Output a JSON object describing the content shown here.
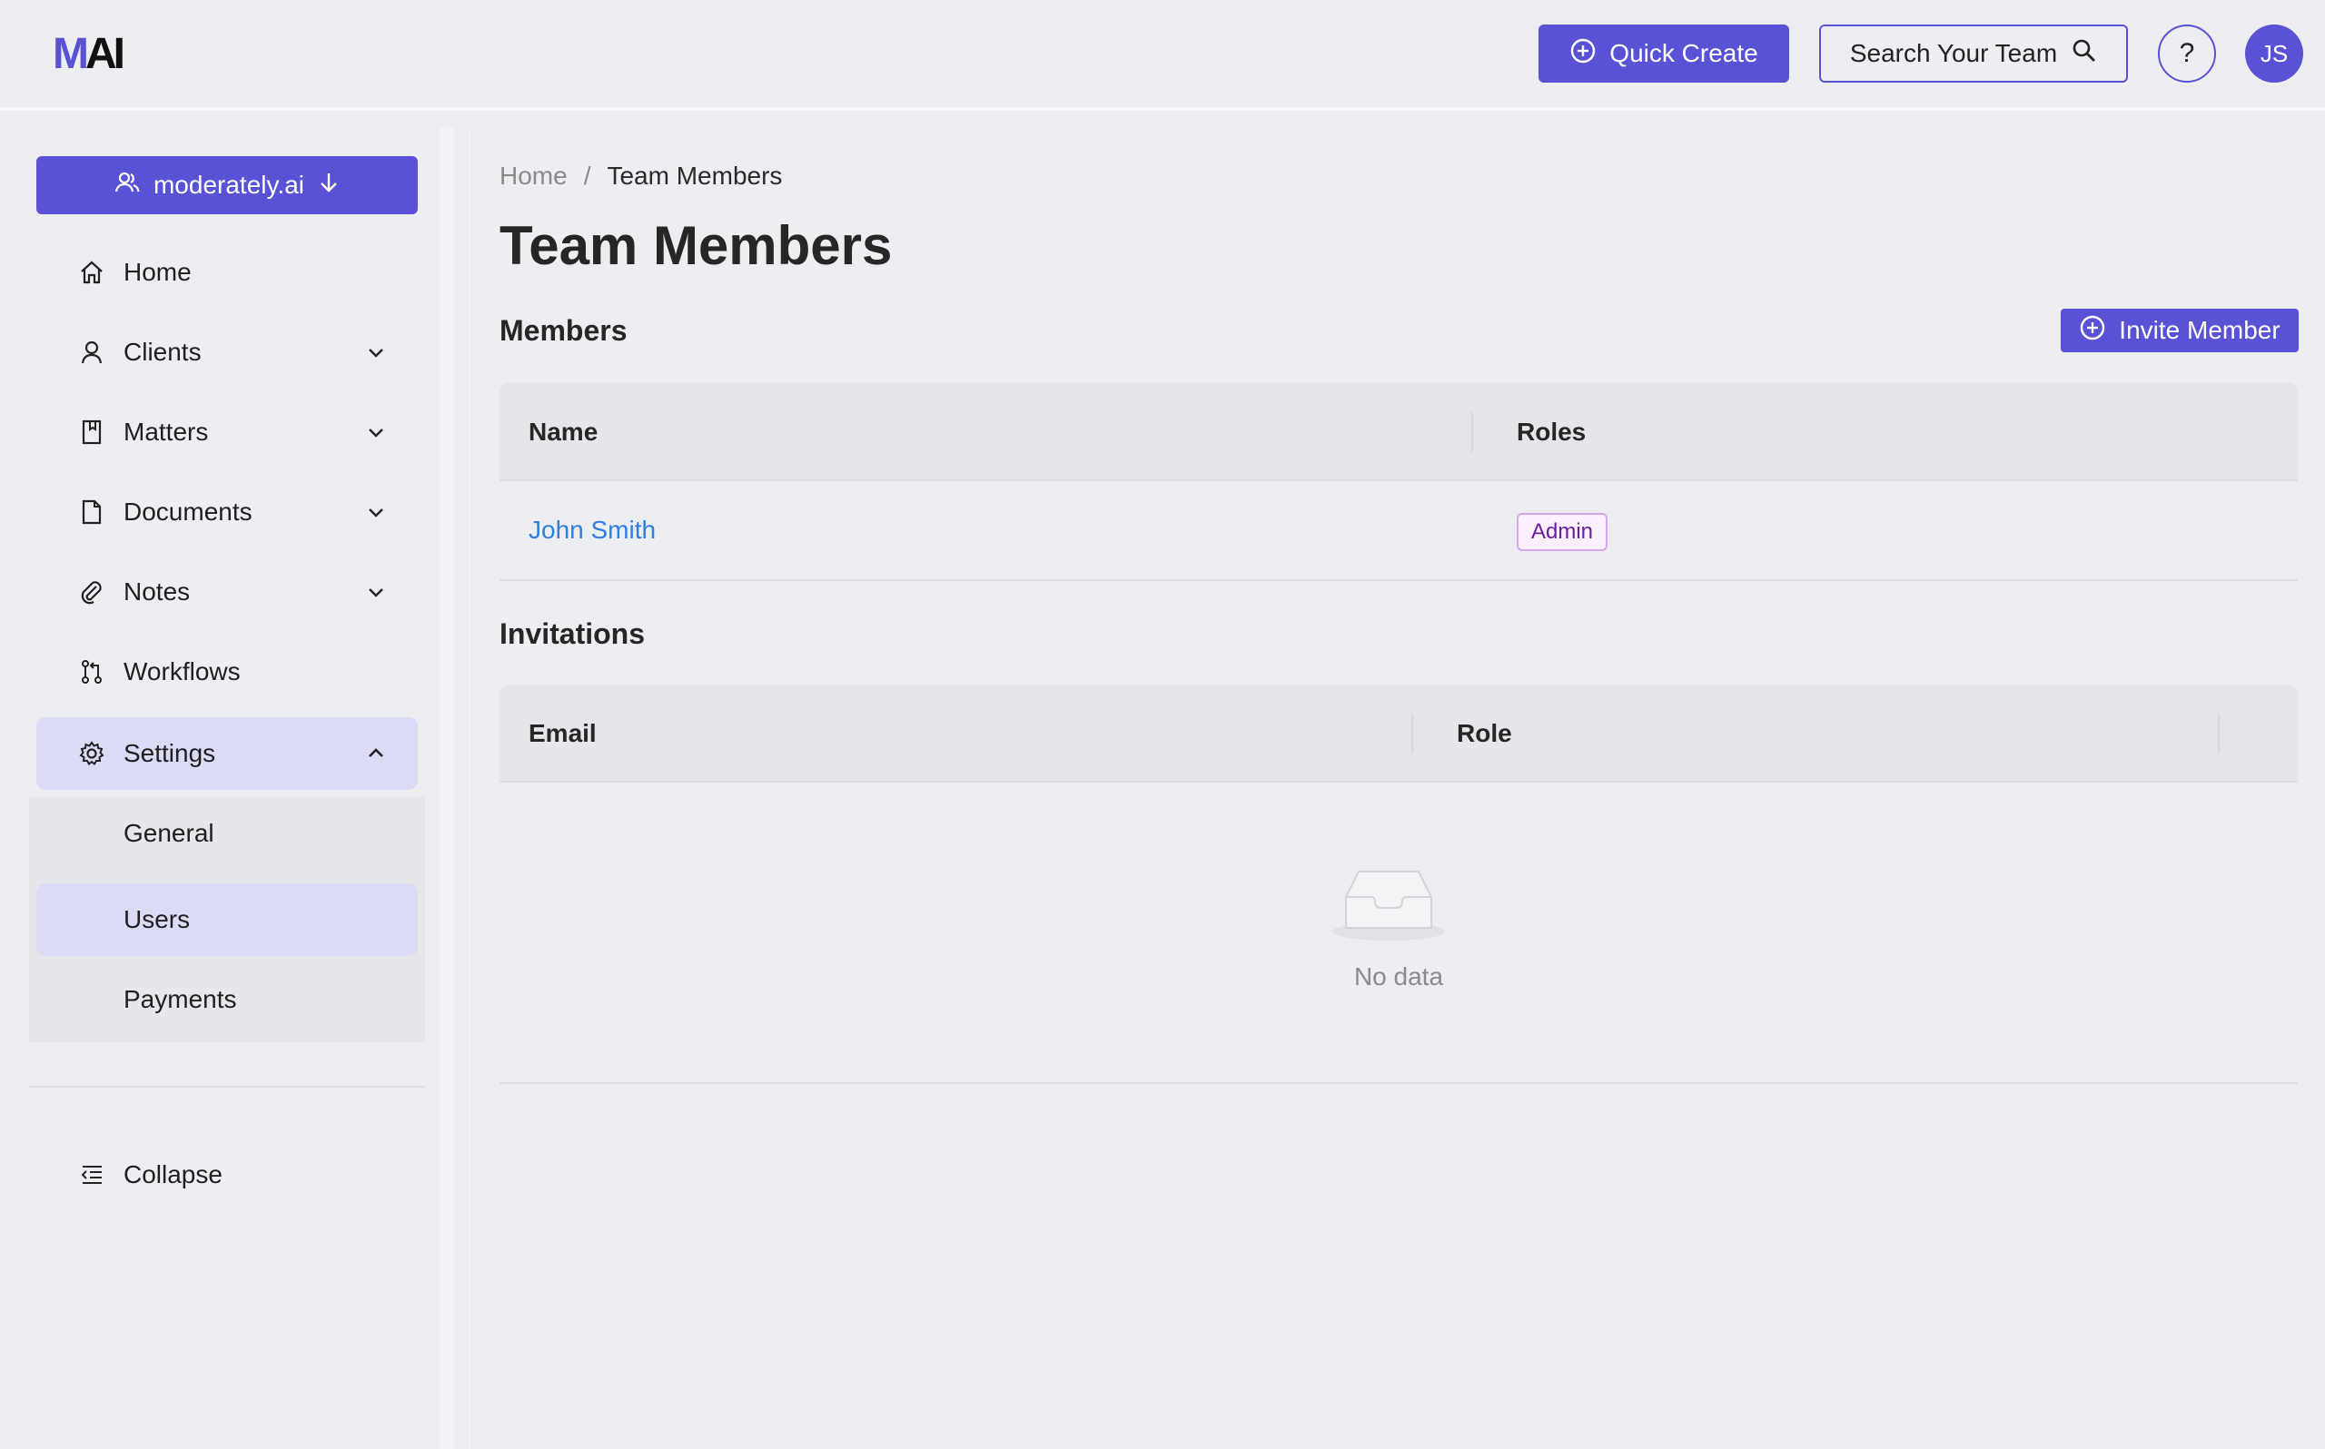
{
  "header": {
    "logo_m": "M",
    "logo_ai": "AI",
    "quick_create_label": "Quick Create",
    "search_label": "Search Your Team",
    "help_label": "?",
    "avatar_initials": "JS"
  },
  "sidebar": {
    "org_label": "moderately.ai",
    "items": [
      {
        "label": "Home",
        "icon": "home-icon"
      },
      {
        "label": "Clients",
        "icon": "user-icon"
      },
      {
        "label": "Matters",
        "icon": "bookmark-icon"
      },
      {
        "label": "Documents",
        "icon": "document-icon"
      },
      {
        "label": "Notes",
        "icon": "paperclip-icon"
      },
      {
        "label": "Workflows",
        "icon": "workflow-icon"
      },
      {
        "label": "Settings",
        "icon": "gear-icon"
      }
    ],
    "settings_sub": [
      {
        "label": "General"
      },
      {
        "label": "Users"
      },
      {
        "label": "Payments"
      }
    ],
    "collapse_label": "Collapse"
  },
  "main": {
    "breadcrumb": {
      "home": "Home",
      "separator": "/",
      "current": "Team Members"
    },
    "title": "Team Members",
    "members_section": "Members",
    "invite_label": "Invite Member",
    "members_table": {
      "columns": [
        "Name",
        "Roles"
      ],
      "rows": [
        {
          "name": "John Smith",
          "role": "Admin"
        }
      ]
    },
    "invitations_section": "Invitations",
    "invitations_table": {
      "columns": [
        "Email",
        "Role"
      ],
      "empty_text": "No data"
    }
  },
  "colors": {
    "accent": "#5a52d5",
    "active_nav_bg": "#dcdbf5",
    "link": "#2f7fe0",
    "tag_text": "#6b1d9e",
    "tag_border": "#d5a6f2"
  }
}
